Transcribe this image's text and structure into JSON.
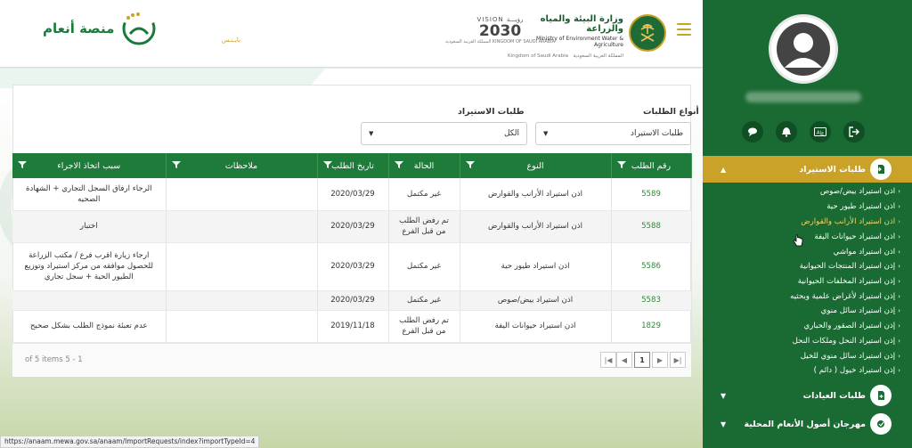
{
  "header": {
    "platform_name": "منصة أنعام",
    "platform_sub": "بايـتـس",
    "vision": {
      "top": "VISION رؤيـــة",
      "year": "2030",
      "caption": "المملكة العربية السعودية KINGDOM OF SAUDI ARABIA"
    },
    "ministry_ar": "وزارة البيئة والمياه والزراعة",
    "ministry_en": "Ministry of Environment Water & Agriculture",
    "kingdom_en": "Kingdom of Saudi Arabia",
    "kingdom_ar": "المملكة العربية السعودية"
  },
  "filters": {
    "type_label": "أنواع الطلبات",
    "type_value": "طلبات الاستيراد",
    "import_label": "طلبات الاستيراد",
    "import_value": "الكل"
  },
  "table": {
    "headers": [
      "رقم الطلب",
      "النوع",
      "الحالة",
      "تاريخ الطلب",
      "ملاحظات",
      "سبب اتخاذ الاجراء"
    ],
    "rows": [
      {
        "id": "5589",
        "type": "اذن استيراد الأرانب والقوارض",
        "status": "غير مكتمل",
        "date": "2020/03/29",
        "notes": "",
        "reason": "الرجاء ارفاق السجل التجاري + الشهادة الصحيه"
      },
      {
        "id": "5588",
        "type": "اذن استيراد الأرانب والقوارض",
        "status": "تم رفض الطلب من قبل الفرع",
        "date": "2020/03/29",
        "notes": "",
        "reason": "اختبار"
      },
      {
        "id": "5586",
        "type": "اذن استيراد طيور حية",
        "status": "غير مكتمل",
        "date": "2020/03/29",
        "notes": "",
        "reason": "ارجاء زيارة اقرب فرع / مكتب الزراعة للحصول موافقه من مركز استيراد وتوزيع الطيور الحية + سجل تجاري"
      },
      {
        "id": "5583",
        "type": "اذن استيراد بيض/صوص",
        "status": "غير مكتمل",
        "date": "2020/03/29",
        "notes": "",
        "reason": ""
      },
      {
        "id": "1829",
        "type": "اذن استيراد حيوانات اليفة",
        "status": "تم رفض الطلب من قبل الفرع",
        "date": "2019/11/18",
        "notes": "",
        "reason": "عدم تعبئة نموذج الطلب بشكل صحيح"
      }
    ]
  },
  "pager": {
    "current_page": "1",
    "info": "of 5 items 5 - 1"
  },
  "status_url": "https://anaam.mewa.gov.sa/anaam/ImportRequests/index?importTypeId=4",
  "sidebar": {
    "menu": [
      {
        "label": "طلبات الاستيراد",
        "expanded": true
      },
      {
        "label": "طلبات العيادات",
        "expanded": false
      },
      {
        "label": "مهرجان أصول الأنعام المحلية",
        "expanded": false
      }
    ],
    "sub_items": [
      "اذن استيراد بيض/صوص",
      "اذن استيراد طيور حية",
      "اذن استيراد الأرانب والقوارض",
      "اذن استيراد حيوانات اليفة",
      "اذن استيراد مواشي",
      "إذن استيراد المنتجات الحيوانية",
      "إذن استيراد المخلفات الحيوانية",
      "إذن استيراد لأغراض علمية وبحثيه",
      "إذن استيراد سائل منوي",
      "إذن استيراد الصقور والحباري",
      "إذن استيراد النحل وملكات النحل",
      "إذن استيراد سائل منوي للخيل",
      "إذن استيراد خيول ( دائم )"
    ],
    "selected_index": 2
  },
  "colors": {
    "green": "#1e7b3a",
    "dark_green": "#1a6b33",
    "gold": "#c9a227"
  }
}
